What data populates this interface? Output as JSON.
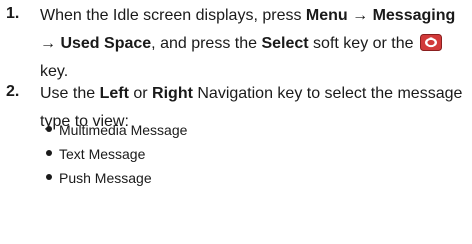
{
  "steps": [
    {
      "number": "1.",
      "line1": {
        "t1": "When the Idle screen displays, press ",
        "b1": "Menu",
        "arrow1": " → ",
        "b2": "Messaging"
      },
      "line2": {
        "arrow": "→ ",
        "b1": "Used Space",
        "t1": ", and press the ",
        "b2": "Select",
        "t2": " soft key or the "
      },
      "line3": "key."
    },
    {
      "number": "2.",
      "line1": {
        "t1": "Use the ",
        "b1": "Left",
        "t2": " or ",
        "b2": "Right",
        "t3": " Navigation key to select the message"
      },
      "line2": "type to view:",
      "bullets": [
        "Multimedia Message",
        "Text Message",
        "Push Message"
      ]
    }
  ],
  "icons": {
    "ok_key": "ok-key-icon"
  },
  "colors": {
    "text": "#1a1a1a",
    "key_icon_bg": "#d23a3a"
  }
}
